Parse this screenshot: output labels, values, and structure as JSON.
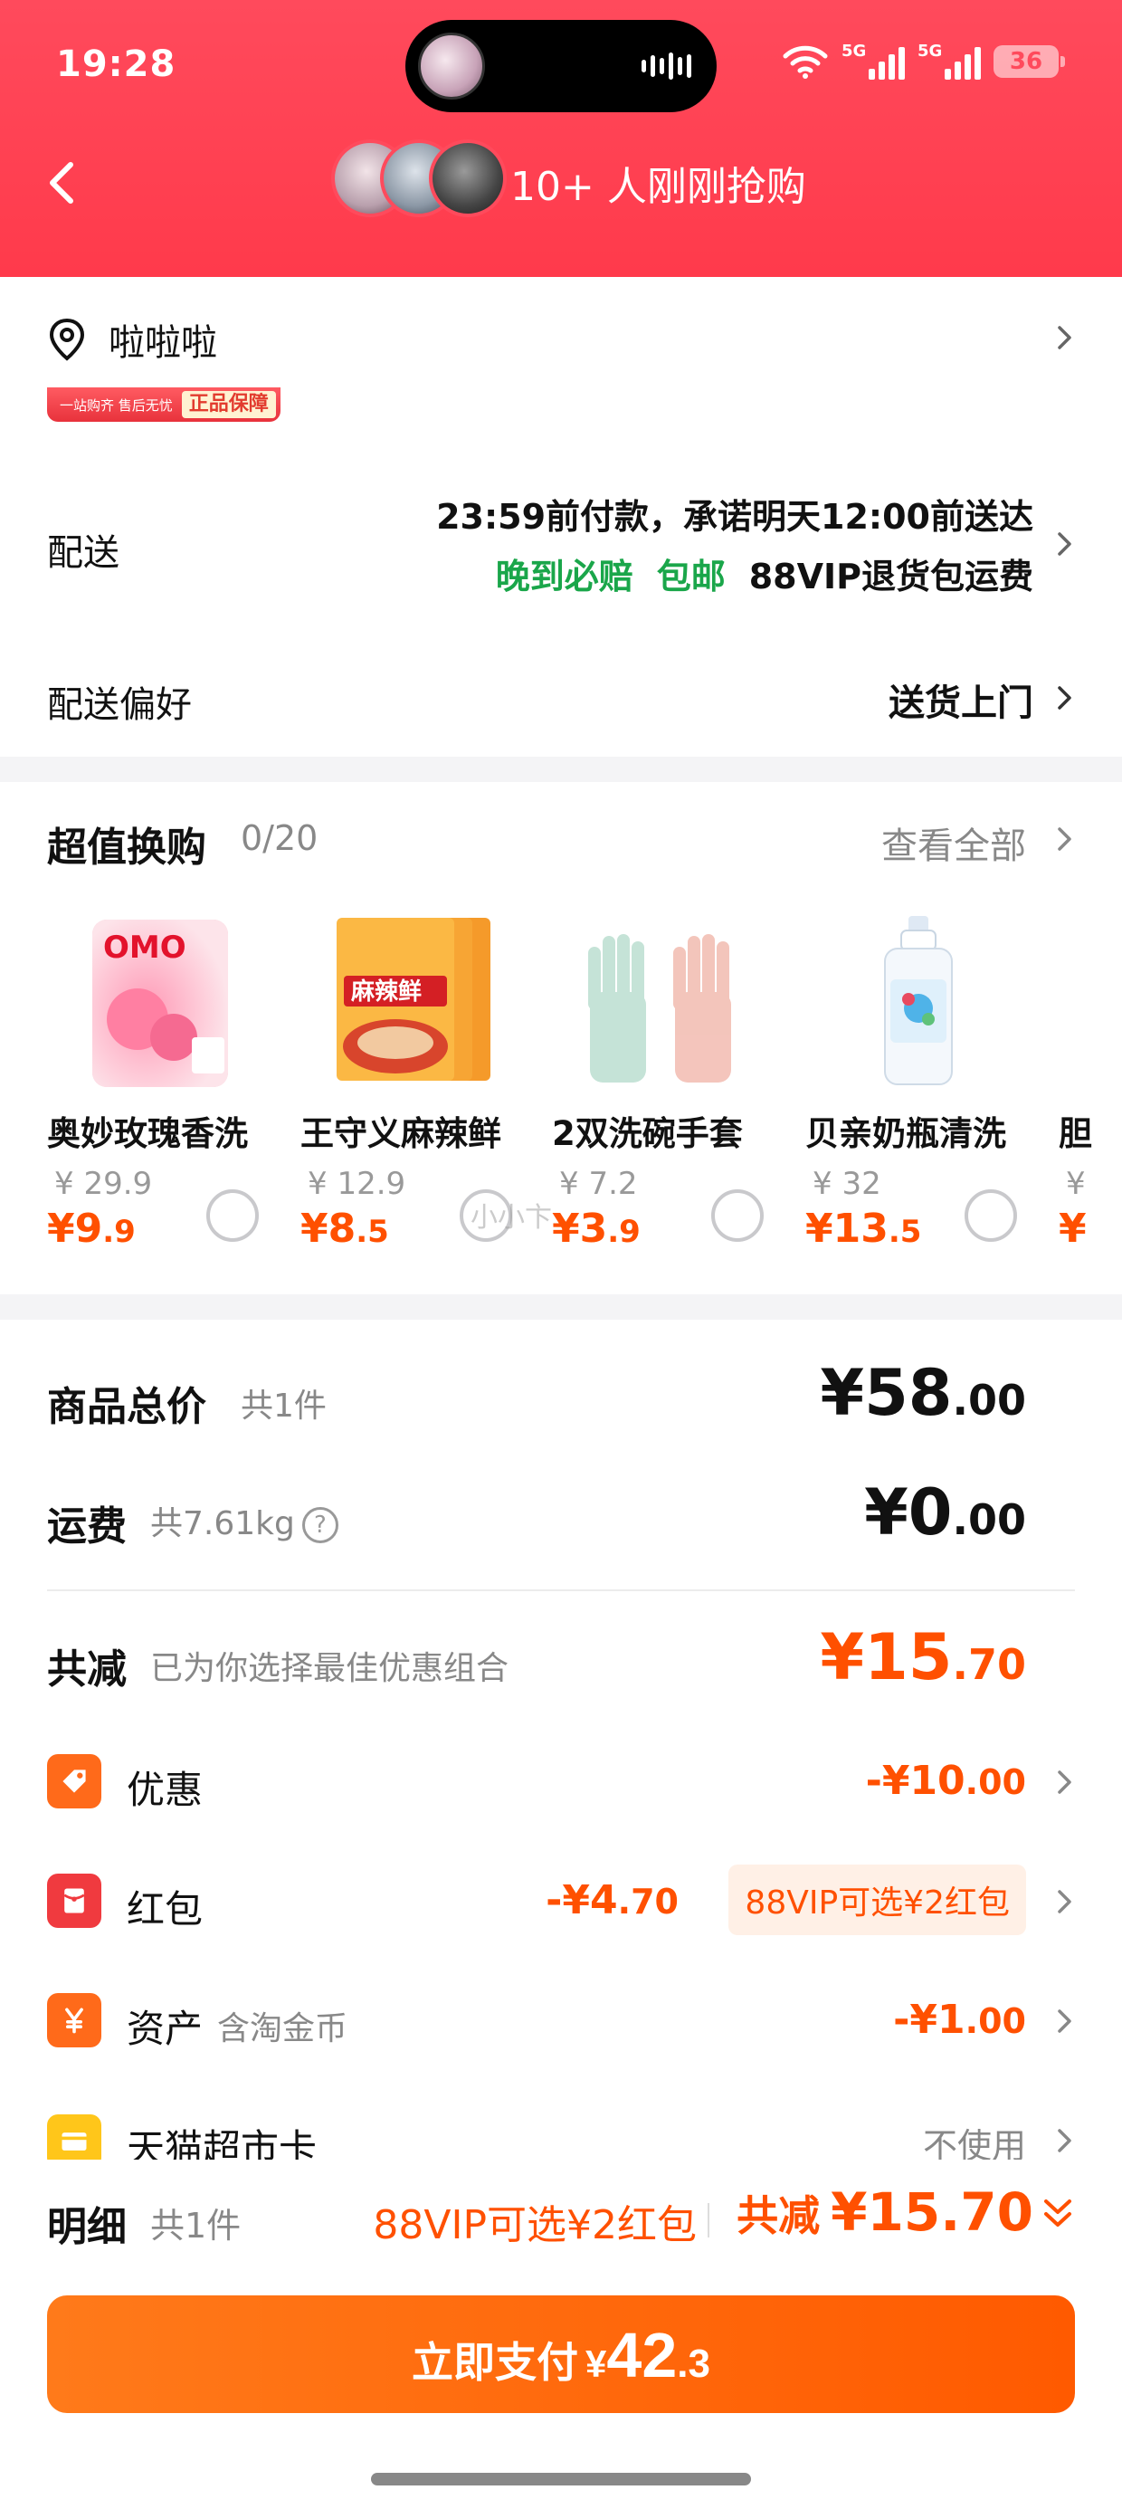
{
  "status_bar": {
    "time": "19:28",
    "network_1": "5G",
    "network_2": "5G",
    "battery": "36"
  },
  "header": {
    "buyers_text": "10+ 人刚刚抢购"
  },
  "address": {
    "text": "啦啦啦",
    "banner_left": "一站购齐 售后无忧",
    "banner_tag": "正品保障"
  },
  "delivery": {
    "label": "配送",
    "line1": "23:59前付款，承诺明天12:00前送达",
    "late_comp": "晚到必赔",
    "free_ship": "包邮",
    "vip_return": "88VIP退货包运费"
  },
  "preference": {
    "label": "配送偏好",
    "value": "送货上门"
  },
  "swap": {
    "title": "超值换购",
    "count": "0/20",
    "see_all": "查看全部",
    "products": [
      {
        "name": "奥妙玫瑰香洗",
        "original": "¥ 29.9",
        "price_int": "¥9",
        "price_dec": ".9"
      },
      {
        "name": "王守义麻辣鲜",
        "original": "¥ 12.9",
        "price_int": "¥8",
        "price_dec": ".5"
      },
      {
        "name": "2双洗碗手套",
        "original": "¥ 7.2",
        "price_int": "¥3",
        "price_dec": ".9"
      },
      {
        "name": "贝亲奶瓶清洗",
        "original": "¥ 32",
        "price_int": "¥13",
        "price_dec": ".5"
      },
      {
        "name": "胆",
        "original": "¥",
        "price_int": "¥",
        "price_dec": ""
      }
    ],
    "watermark": "小小卞"
  },
  "totals": {
    "goods_label": "商品总价",
    "goods_count": "共1件",
    "goods_int": "¥58",
    "goods_dec": ".00",
    "freight_label": "运费",
    "freight_weight": "共7.61kg",
    "freight_int": "¥0",
    "freight_dec": ".00",
    "reduce_label": "共减",
    "reduce_sub": "已为你选择最佳优惠组合",
    "reduce_int": "¥15",
    "reduce_dec": ".70"
  },
  "discounts": [
    {
      "label": "优惠",
      "sub": "",
      "value_int": "-¥10",
      "value_dec": ".00",
      "icon": "tag-icon"
    },
    {
      "label": "红包",
      "sub": "",
      "value_int": "-¥4",
      "value_dec": ".70",
      "icon": "red-packet-icon"
    },
    {
      "label": "资产",
      "sub": "含淘金币",
      "value_int": "-¥1",
      "value_dec": ".00",
      "icon": "yen-icon"
    },
    {
      "label": "天猫超市卡",
      "sub": "",
      "value_int": "不使用",
      "value_dec": "",
      "icon": "card-icon"
    }
  ],
  "vip_pill": "88VIP可选¥2红包",
  "detail": {
    "title": "明细",
    "count": "共1件",
    "vip": "88VIP可选¥2红包",
    "total_label": "共减",
    "total_value": "¥15.70"
  },
  "pay": {
    "label": "立即支付",
    "currency": "¥",
    "int": "42",
    "dec": ".3"
  },
  "colors": {
    "header": "#ff4a5c",
    "accent": "#ff5000",
    "green": "#1aa64a"
  }
}
